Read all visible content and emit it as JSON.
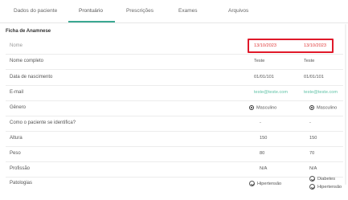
{
  "tabs": [
    {
      "label": "Dados do paciente"
    },
    {
      "label": "Prontuário"
    },
    {
      "label": "Prescrições"
    },
    {
      "label": "Exames"
    },
    {
      "label": "Arquivos"
    }
  ],
  "section_title": "Ficha de Anamnese",
  "rows": {
    "nome": {
      "label": "Nome",
      "v1": "13/10/2023",
      "v2": "13/10/2023"
    },
    "nome_completo": {
      "label": "Nome completo",
      "v1": "Teste",
      "v2": "Teste"
    },
    "nascimento": {
      "label": "Data de nascimento",
      "v1": "01/01/101",
      "v2": "01/01/101"
    },
    "email": {
      "label": "E-mail",
      "v1": "teste@teste.com",
      "v2": "teste@teste.com"
    },
    "genero": {
      "label": "Gênero",
      "v1": "Masculino",
      "v2": "Masculino"
    },
    "identifica": {
      "label": "Como o paciente se identifica?",
      "v1": "-",
      "v2": "-"
    },
    "altura": {
      "label": "Altura",
      "v1": "150",
      "v2": "150"
    },
    "peso": {
      "label": "Peso",
      "v1": "80",
      "v2": "70"
    },
    "profissao": {
      "label": "Profissão",
      "v1": "N/A",
      "v2": "N/A"
    },
    "patologias": {
      "label": "Patologias",
      "v1": "Hipertensão",
      "v2_items": [
        "Diabetes",
        "Hipertensão"
      ]
    }
  },
  "colors": {
    "accent": "#3aa892",
    "highlight": "#e0192a",
    "date": "#e03a3a",
    "email": "#5fc2a6"
  }
}
